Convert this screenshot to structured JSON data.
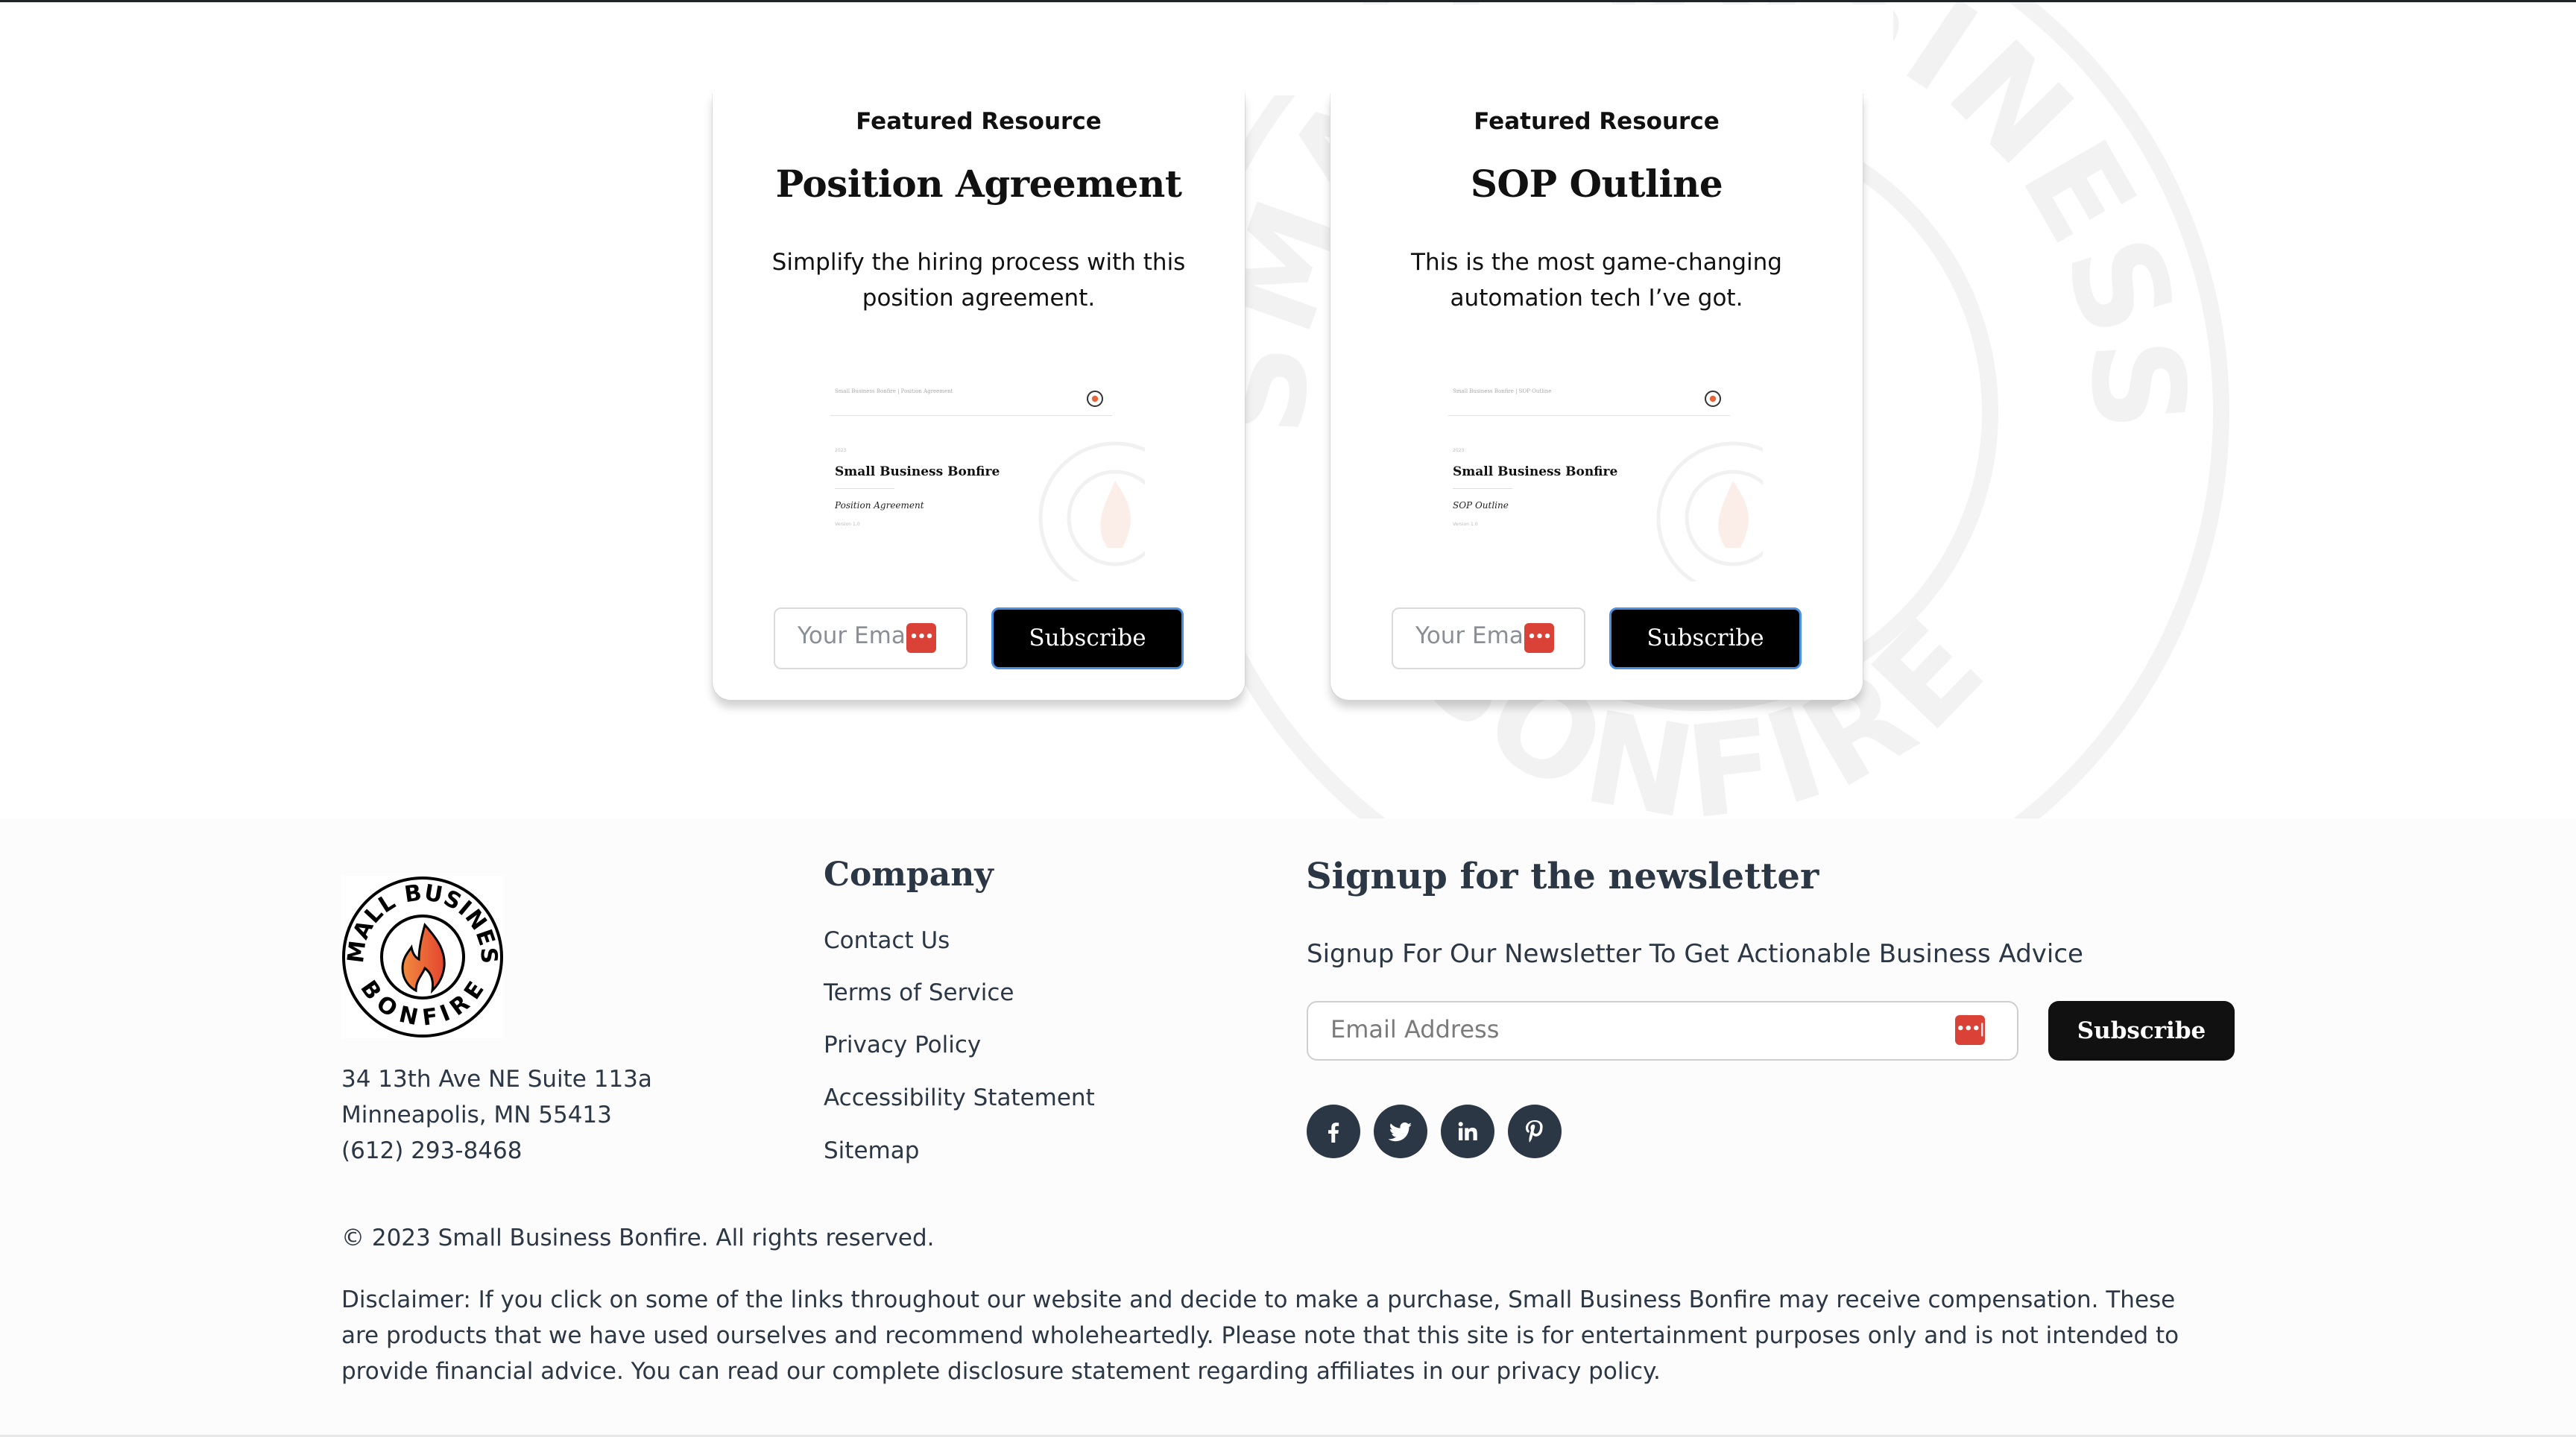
{
  "watermark": {
    "top_text": "SMALL BUSINESS",
    "bottom_text": "BONFIRE"
  },
  "cards": [
    {
      "eyebrow": "Featured Resource",
      "title": "Position Agreement",
      "description": "Simplify the hiring process with this position agreement.",
      "thumbnail": {
        "header": "Small Business Bonfire | Position Agreement",
        "year": "2023",
        "brand": "Small Business Bonfire",
        "doc_title": "Position Agreement",
        "version": "Version 1.0"
      },
      "email_placeholder": "Your Email",
      "subscribe_label": "Subscribe"
    },
    {
      "eyebrow": "Featured Resource",
      "title": "SOP Outline",
      "description": "This is the most game-changing automation tech I’ve got.",
      "thumbnail": {
        "header": "Small Business Bonfire | SOP Outline",
        "year": "2023",
        "brand": "Small Business Bonfire",
        "doc_title": "SOP Outline",
        "version": "Version 1.0"
      },
      "email_placeholder": "Your Email",
      "subscribe_label": "Subscribe"
    }
  ],
  "footer": {
    "logo": {
      "top_text": "SMALL BUSINESS",
      "bottom_text": "BONFIRE"
    },
    "address": [
      "34 13th Ave NE Suite 113a",
      "Minneapolis, MN 55413",
      "(612) 293-8468"
    ],
    "company": {
      "heading": "Company",
      "links": [
        "Contact Us",
        "Terms of Service",
        "Privacy Policy",
        "Accessibility Statement",
        "Sitemap"
      ]
    },
    "newsletter": {
      "heading": "Signup for the newsletter",
      "subtitle": "Signup For Our Newsletter To Get Actionable Business Advice",
      "email_placeholder": "Email Address",
      "subscribe_label": "Subscribe",
      "password_manager_icon": "•••|"
    },
    "social": [
      {
        "name": "facebook-icon"
      },
      {
        "name": "twitter-icon"
      },
      {
        "name": "linkedin-icon"
      },
      {
        "name": "pinterest-icon"
      }
    ],
    "copyright": "© 2023 Small Business Bonfire. All rights reserved.",
    "disclaimer": "Disclaimer: If you click on some of the links throughout our website and decide to make a purchase, Small Business Bonfire may receive compensation. These are products that we have used ourselves and recommend wholeheartedly. Please note that this site is for entertainment purposes only and is not intended to provide financial advice. You can read our complete disclosure statement regarding affiliates in our privacy policy."
  },
  "colors": {
    "text_dark": "#2b3744",
    "button_black": "#000000",
    "button_border": "#4a8fe0",
    "password_badge": "#da4238",
    "flame_orange": "#e8643a",
    "footer_bg": "#fcfcfc"
  }
}
